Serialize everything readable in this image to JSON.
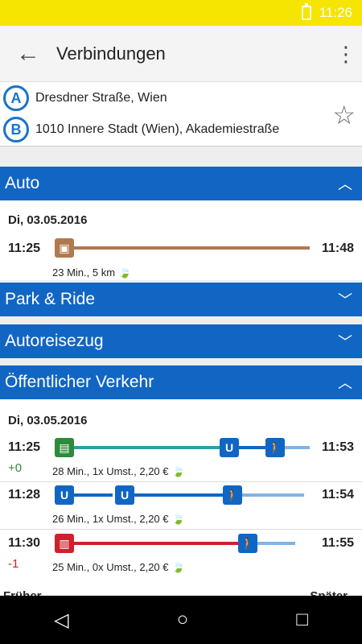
{
  "status": {
    "time": "11:26"
  },
  "appbar": {
    "title": "Verbindungen"
  },
  "locations": {
    "a_label": "A",
    "a_text": "Dresdner Straße, Wien",
    "b_label": "B",
    "b_text": "1010 Innere Stadt (Wien), Akademiestraße"
  },
  "sections": {
    "auto": "Auto",
    "park": "Park & Ride",
    "autoreisezug": "Autoreisezug",
    "oeffentlich": "Öffentlicher Verkehr"
  },
  "auto_card": {
    "date": "Di, 03.05.2016",
    "dep": "11:25",
    "arr": "11:48",
    "info": "23 Min., 5 km"
  },
  "public_card": {
    "date": "Di, 03.05.2016",
    "rows": [
      {
        "dep": "11:25",
        "arr": "11:53",
        "delay": "+0",
        "info": "28 Min., 1x Umst., 2,20 €"
      },
      {
        "dep": "11:28",
        "arr": "11:54",
        "delay": "",
        "info": "26 Min., 1x Umst., 2,20 €"
      },
      {
        "dep": "11:30",
        "arr": "11:55",
        "delay": "-1",
        "info": "25 Min., 0x Umst., 2,20 €"
      }
    ]
  },
  "footer": {
    "earlier": "Früher",
    "later": "Später"
  },
  "icons": {
    "u_label": "U"
  },
  "colors": {
    "blue": "#1166c4",
    "yellow": "#f5e500",
    "car": "#b07a50",
    "green": "#2e8b3a",
    "red": "#d0202c"
  }
}
